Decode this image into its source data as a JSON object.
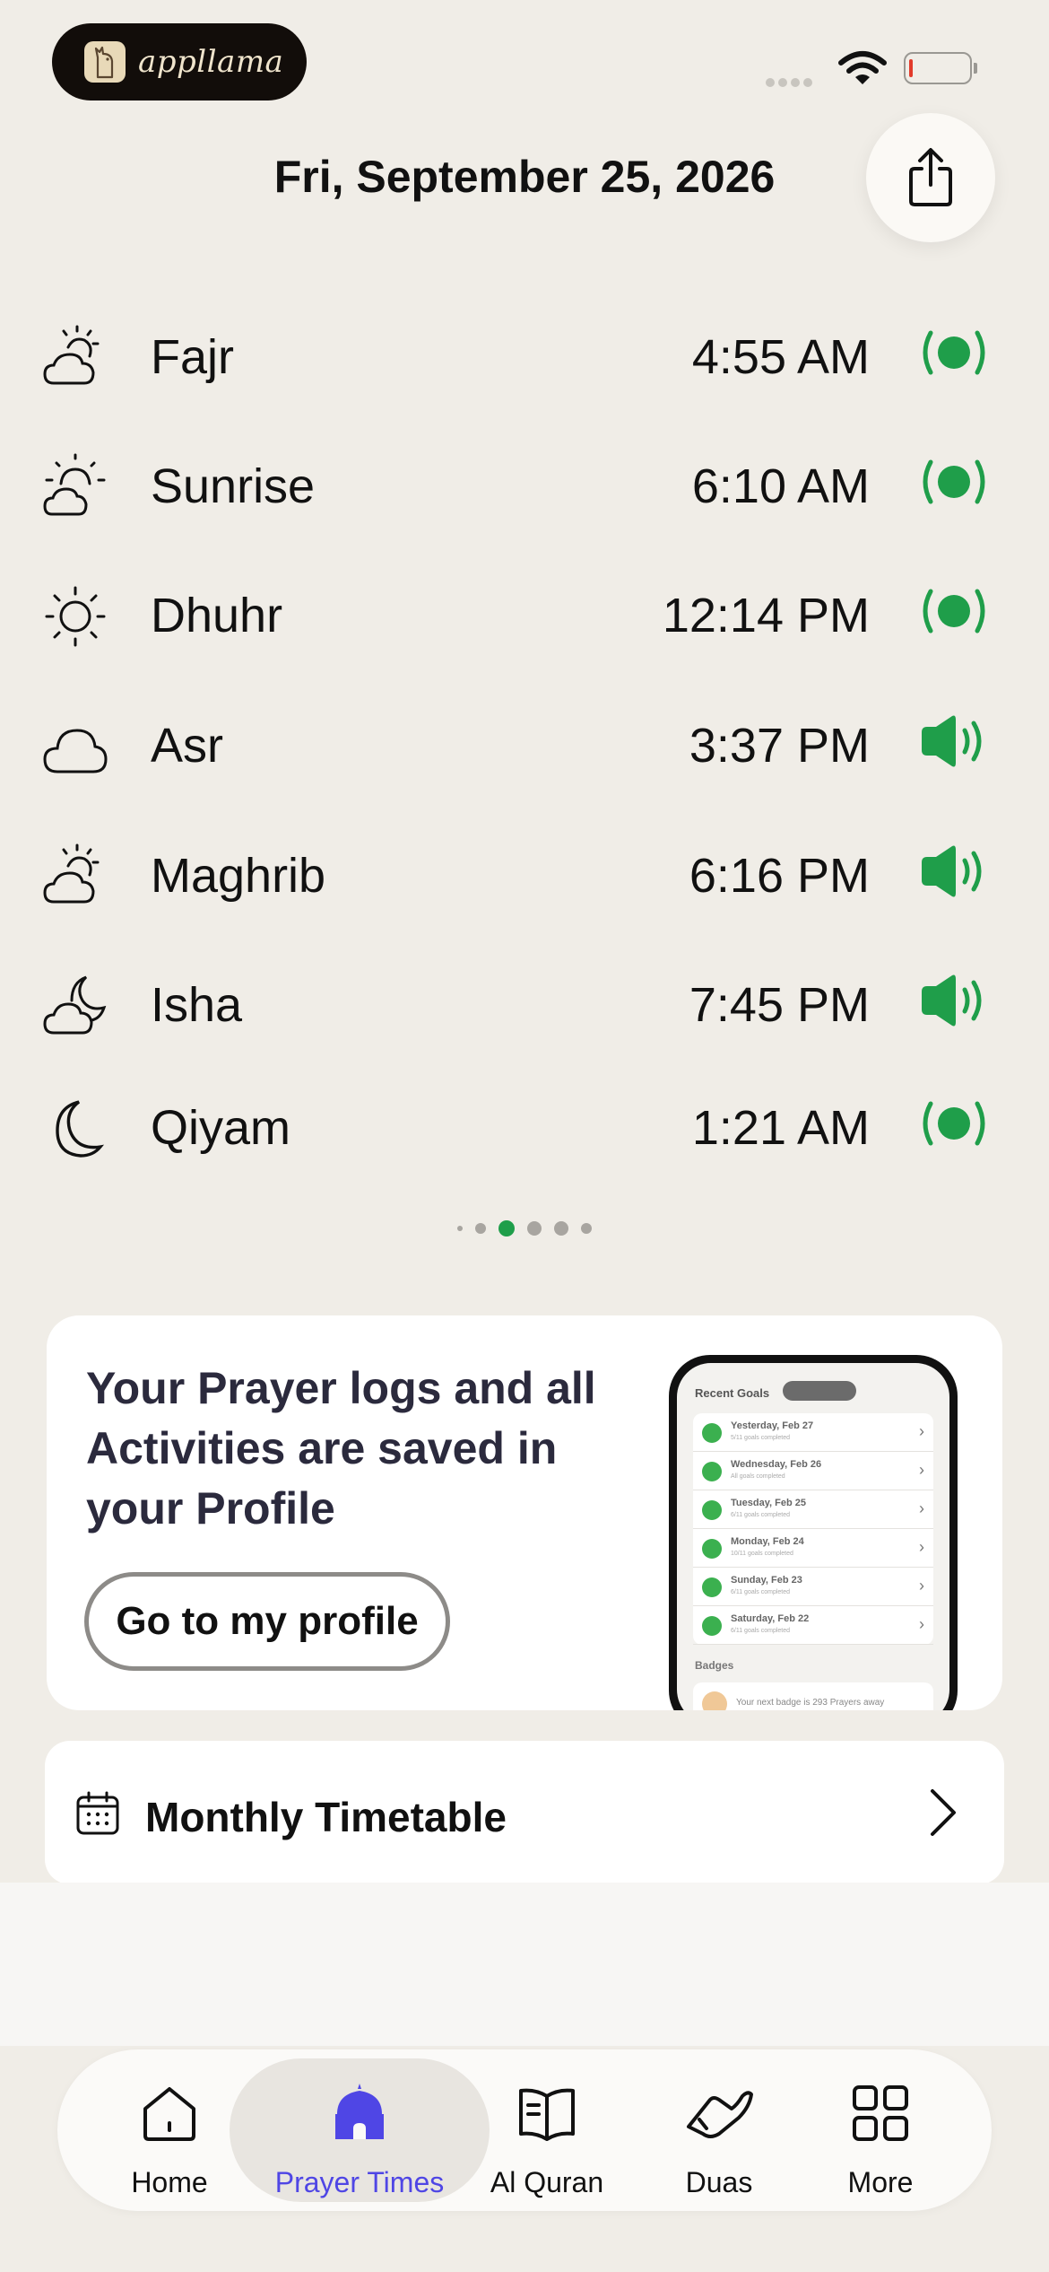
{
  "status": {
    "brand_name": "appllama"
  },
  "header": {
    "date": "Fri, September 25, 2026",
    "share_icon": "share-icon"
  },
  "prayers": [
    {
      "name": "Fajr",
      "time": "4:55 AM",
      "icon": "cloud-sun-icon",
      "alert": "notification-dot"
    },
    {
      "name": "Sunrise",
      "time": "6:10 AM",
      "icon": "sunrise-icon",
      "alert": "notification-dot"
    },
    {
      "name": "Dhuhr",
      "time": "12:14 PM",
      "icon": "sun-icon",
      "alert": "notification-dot"
    },
    {
      "name": "Asr",
      "time": "3:37 PM",
      "icon": "cloud-icon",
      "alert": "speaker"
    },
    {
      "name": "Maghrib",
      "time": "6:16 PM",
      "icon": "cloud-sun-icon",
      "alert": "speaker"
    },
    {
      "name": "Isha",
      "time": "7:45 PM",
      "icon": "cloud-moon-icon",
      "alert": "speaker"
    },
    {
      "name": "Qiyam",
      "time": "1:21 AM",
      "icon": "moon-icon",
      "alert": "notification-dot"
    }
  ],
  "pager": {
    "count": 6,
    "active_index": 2
  },
  "profile_card": {
    "text": "Your Prayer logs and all Activities are saved in your Profile",
    "button_label": "Go to my profile",
    "mock": {
      "recent_goals_label": "Recent Goals",
      "items": [
        {
          "title": "Yesterday, Feb 27",
          "sub": "5/11 goals completed"
        },
        {
          "title": "Wednesday, Feb 26",
          "sub": "All goals completed"
        },
        {
          "title": "Tuesday, Feb 25",
          "sub": "6/11 goals completed"
        },
        {
          "title": "Monday, Feb 24",
          "sub": "10/11 goals completed"
        },
        {
          "title": "Sunday, Feb 23",
          "sub": "6/11 goals completed"
        },
        {
          "title": "Saturday, Feb 22",
          "sub": "6/11 goals completed"
        }
      ],
      "badges_label": "Badges",
      "next_badge": "Your next badge is 293 Prayers away"
    }
  },
  "monthly": {
    "label": "Monthly Timetable"
  },
  "tabs": [
    {
      "label": "Home",
      "icon": "home-icon",
      "active": false
    },
    {
      "label": "Prayer Times",
      "icon": "mosque-icon",
      "active": true
    },
    {
      "label": "Al Quran",
      "icon": "book-icon",
      "active": false
    },
    {
      "label": "Duas",
      "icon": "praying-hands-icon",
      "active": false
    },
    {
      "label": "More",
      "icon": "grid-icon",
      "active": false
    }
  ],
  "colors": {
    "accent_green": "#1f9e4a",
    "active_tab": "#4f46e5",
    "background": "#f0ede7"
  }
}
